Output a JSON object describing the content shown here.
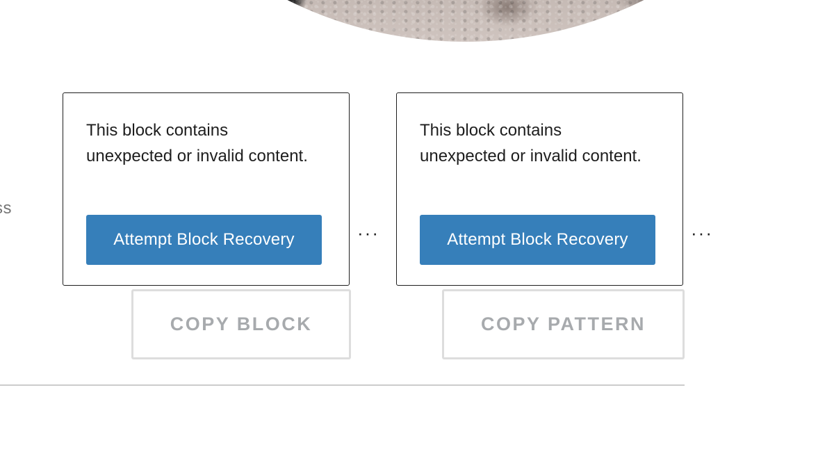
{
  "hero": {
    "image_icon": "photo-image"
  },
  "side_text": "ss",
  "blocks": [
    {
      "warning": "This block contains unexpected or invalid content.",
      "recovery_label": "Attempt Block Recovery",
      "more_label": "⋮",
      "copy_label": "COPY BLOCK"
    },
    {
      "warning": "This block contains unexpected or invalid content.",
      "recovery_label": "Attempt Block Recovery",
      "more_label": "⋮",
      "copy_label": "COPY PATTERN"
    }
  ],
  "colors": {
    "primary": "#367fba",
    "text": "#1e1e1e",
    "muted": "#a7aaad",
    "border": "#dddddd"
  }
}
